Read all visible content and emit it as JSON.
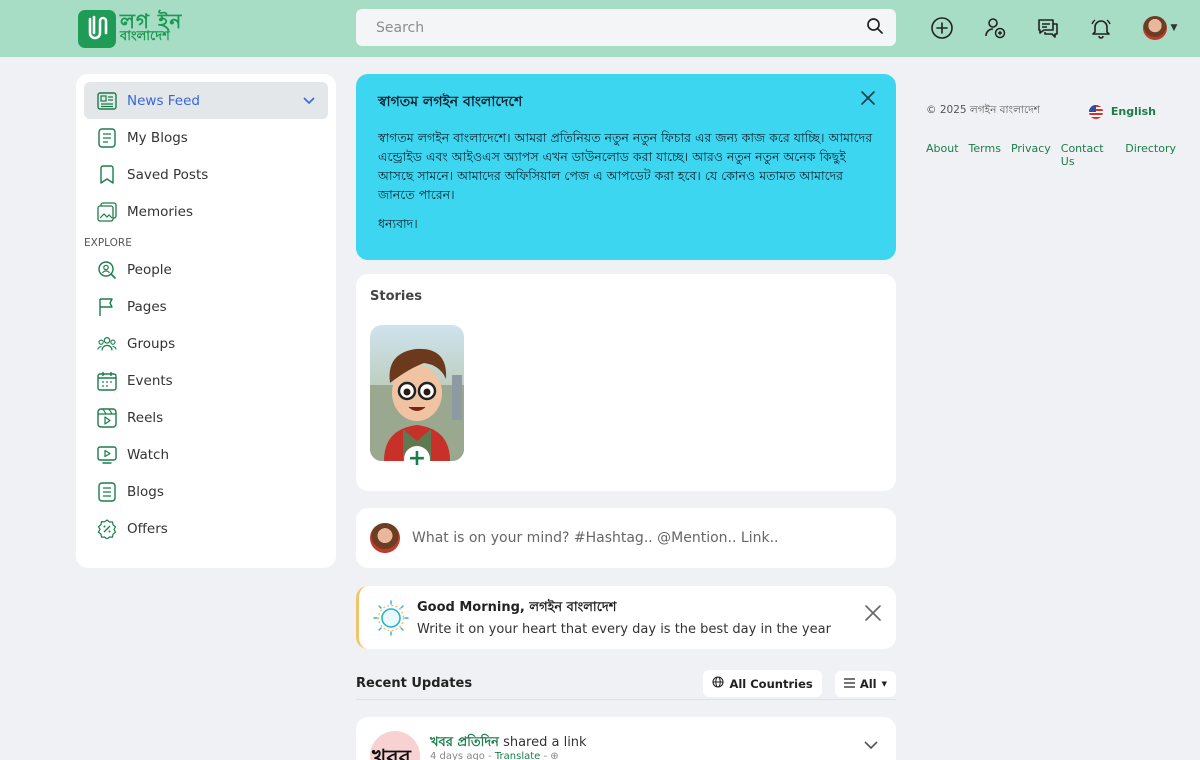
{
  "header": {
    "logo_line1": "লগ ইন",
    "logo_line2": "বাংলাদেশ",
    "search_placeholder": "Search",
    "icons": [
      "plus-circle-icon",
      "add-user-icon",
      "messages-icon",
      "bell-icon",
      "avatar"
    ]
  },
  "sidebar": {
    "items": [
      {
        "label": "News Feed",
        "icon": "newspaper-icon"
      },
      {
        "label": "My Blogs",
        "icon": "document-icon"
      },
      {
        "label": "Saved Posts",
        "icon": "bookmark-icon"
      },
      {
        "label": "Memories",
        "icon": "photos-icon"
      }
    ],
    "explore_label": "EXPLORE",
    "explore_items": [
      {
        "label": "People",
        "icon": "people-search-icon"
      },
      {
        "label": "Pages",
        "icon": "flag-icon"
      },
      {
        "label": "Groups",
        "icon": "groups-icon"
      },
      {
        "label": "Events",
        "icon": "calendar-icon"
      },
      {
        "label": "Reels",
        "icon": "reels-icon"
      },
      {
        "label": "Watch",
        "icon": "watch-icon"
      },
      {
        "label": "Blogs",
        "icon": "blog-icon"
      },
      {
        "label": "Offers",
        "icon": "offer-tag-icon"
      }
    ]
  },
  "welcome": {
    "title": "স্বাগতম লগইন বাংলাদেশে",
    "body": "স্বাগতম লগইন বাংলাদেশে। আমরা প্রতিনিয়ত নতুন নতুন ফিচার এর জন্য কাজ করে যাচ্ছি। আমাদের এন্ড্রোইড এবং আইওএস অ্যাপস এখন ডাউনলোড করা যাচ্ছে। আরও নতুন নতুন অনেক কিছুই আসছে সামনে। আমাদের অফিসিয়াল পেজ এ আপডেট করা হবে। যে কোনও মতামত আমাদের জানতে পারেন।",
    "thanks": "ধন্যবাদ।"
  },
  "stories": {
    "title": "Stories",
    "add_symbol": "+"
  },
  "composer": {
    "placeholder": "What is on your mind? #Hashtag.. @Mention.. Link.."
  },
  "greeting": {
    "title": "Good Morning, লগইন বাংলাদেশ",
    "message": "Write it on your heart that every day is the best day in the year"
  },
  "recent": {
    "title": "Recent Updates",
    "filter_country": "All Countries",
    "filter_type": "All"
  },
  "post": {
    "logo_text": "খবর",
    "author": "খবর প্রতিদিন",
    "action": " shared a link",
    "time": "4 days ago",
    "translate": "Translate",
    "sep": " - "
  },
  "footer": {
    "copyright": "© 2025 লগইন বাংলাদেশ",
    "language": "English",
    "links": [
      "About",
      "Terms",
      "Privacy",
      "Contact Us",
      "Directory"
    ]
  }
}
